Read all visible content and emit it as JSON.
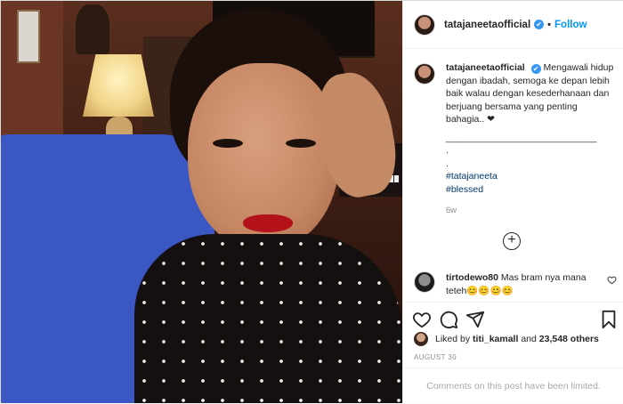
{
  "post": {
    "username": "tatajaneetaofficial",
    "verified_mark": "✔",
    "separator": "•",
    "follow_label": "Follow"
  },
  "caption": {
    "username": "tatajaneetaofficial",
    "text": "Mengawali hidup dengan ibadah, semoga ke depan lebih baik walau dengan kesederhanaan dan berjuang bersama yang penting bahagia.. ❤",
    "divider": "_____________________________",
    "dot1": ".",
    "dot2": ".",
    "hashtags": [
      "#tatajaneeta",
      "#blessed"
    ],
    "time": "6w"
  },
  "load_more_symbol": "+",
  "comment": {
    "username": "tirtodewo80",
    "text": "Mas bram nya mana teteh😊😊😊😊"
  },
  "icons": {
    "like": "heart-icon",
    "comment": "comment-icon",
    "share": "paper-plane-icon",
    "save": "bookmark-icon"
  },
  "likes": {
    "prefix": "Liked by ",
    "user": "titi_kamall",
    "middle": " and ",
    "count": "23,548 others"
  },
  "date": "AUGUST 30",
  "comments_limited": "Comments on this post have been limited.",
  "colors": {
    "link_blue": "#0095f6",
    "hashtag": "#00376b",
    "muted": "#8e8e8e"
  }
}
